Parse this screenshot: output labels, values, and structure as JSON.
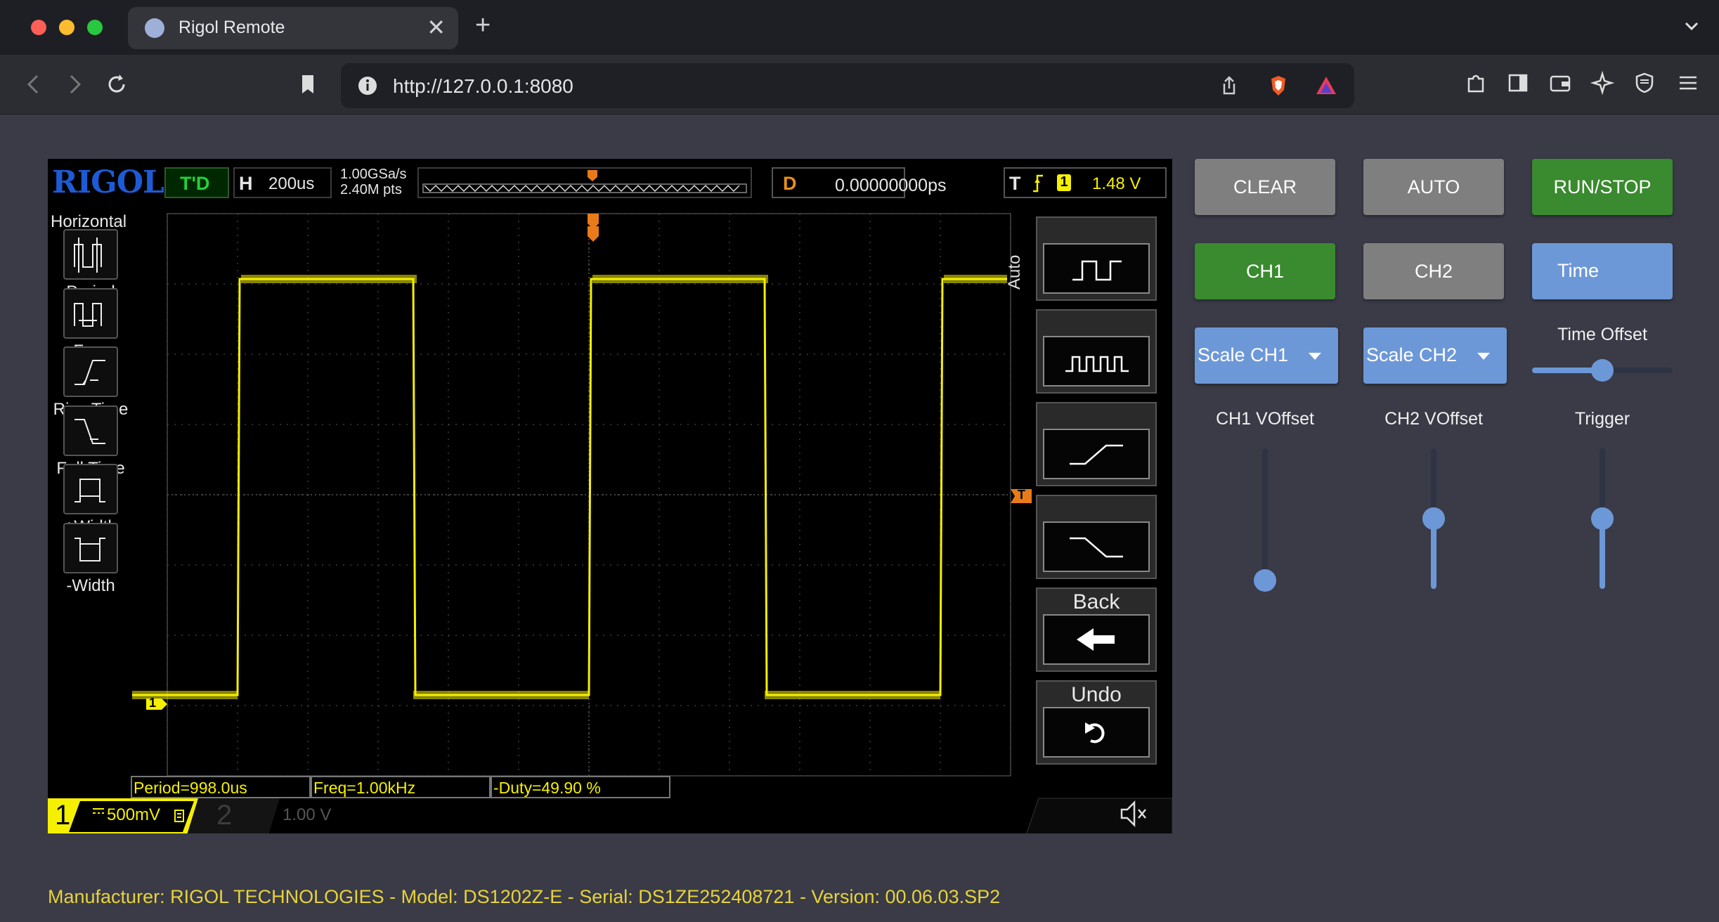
{
  "browser": {
    "tab_title": "Rigol Remote",
    "tab_close": "✕",
    "new_tab": "+",
    "url": "http://127.0.0.1:8080"
  },
  "scope": {
    "logo": "RIGOL",
    "status": "T'D",
    "h_label": "H",
    "timebase": "200us",
    "sample_rate": "1.00GSa/s",
    "memory_depth": "2.40M pts",
    "d_label": "D",
    "delay": "0.00000000ps",
    "trigger_label": "T",
    "trigger_source": "1",
    "trigger_level": "1.48 V",
    "menu_title": "Horizontal",
    "measure_items": [
      {
        "label": "Period",
        "icon": "period-icon"
      },
      {
        "label": "Freq",
        "icon": "freq-icon"
      },
      {
        "label": "Rise Time",
        "icon": "rise-time-icon"
      },
      {
        "label": "Fall Time",
        "icon": "fall-time-icon"
      },
      {
        "label": "+Width",
        "icon": "pos-width-icon"
      },
      {
        "label": "-Width",
        "icon": "neg-width-icon"
      }
    ],
    "mode": "Auto",
    "softkeys": {
      "back": "Back",
      "undo": "Undo"
    },
    "measurements": [
      "Period=998.0us",
      "Freq=1.00kHz",
      "-Duty=49.90 %"
    ],
    "ch1": {
      "number": "1",
      "scale": "500mV"
    },
    "ch2": {
      "number": "2",
      "scale": "1.00 V"
    },
    "trace_color": "#f5f000",
    "ch1_marker": "1",
    "trig_marker": "T"
  },
  "controls": {
    "clear": "CLEAR",
    "auto": "AUTO",
    "run_stop": "RUN/STOP",
    "ch1": "CH1",
    "ch2": "CH2",
    "time": "Time",
    "scale_ch1": "Scale CH1",
    "scale_ch2": "Scale CH2",
    "time_offset_label": "Time Offset",
    "time_offset_value": 0.5,
    "ch1_voffset_label": "CH1 VOffset",
    "ch1_voffset_value": 0.06,
    "ch2_voffset_label": "CH2 VOffset",
    "ch2_voffset_value": 0.5,
    "trigger_label": "Trigger",
    "trigger_value": 0.5,
    "colors": {
      "gray": "#7f7f7f",
      "green": "#3a8a2f",
      "blue": "#6d98d8"
    }
  },
  "footer": "Manufacturer: RIGOL TECHNOLOGIES - Model: DS1202Z-E - Serial: DS1ZE252408721 - Version: 00.06.03.SP2"
}
